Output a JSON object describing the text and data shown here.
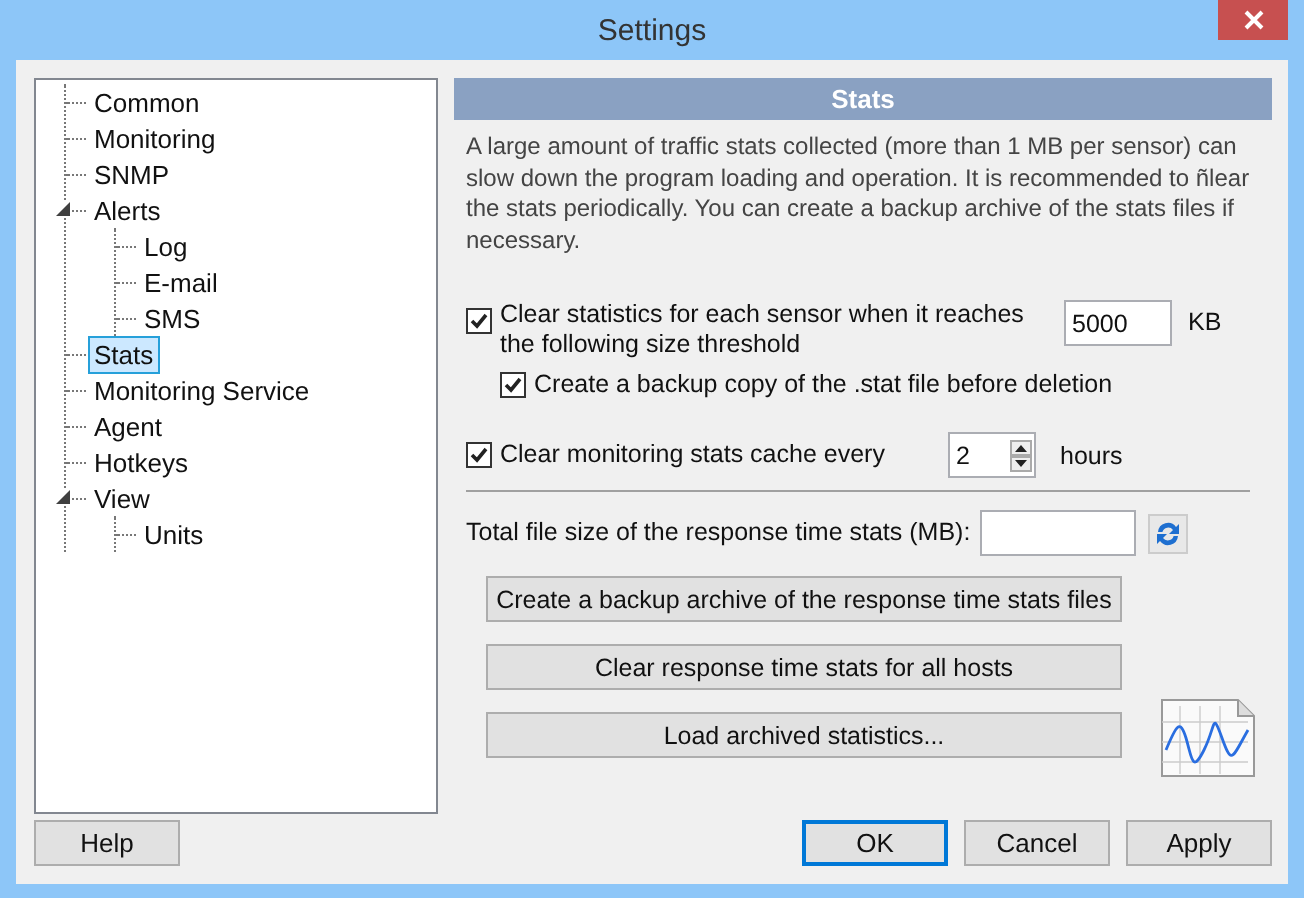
{
  "window": {
    "title": "Settings"
  },
  "tree": [
    {
      "label": "Common",
      "selected": false
    },
    {
      "label": "Monitoring",
      "selected": false
    },
    {
      "label": "SNMP",
      "selected": false
    },
    {
      "label": "Alerts",
      "selected": false,
      "expanded": true,
      "children": [
        {
          "label": "Log",
          "selected": false
        },
        {
          "label": "E-mail",
          "selected": false
        },
        {
          "label": "SMS",
          "selected": false
        }
      ]
    },
    {
      "label": "Stats",
      "selected": true
    },
    {
      "label": "Monitoring Service",
      "selected": false
    },
    {
      "label": "Agent",
      "selected": false
    },
    {
      "label": "Hotkeys",
      "selected": false
    },
    {
      "label": "View",
      "selected": false,
      "expanded": true,
      "children": [
        {
          "label": "Units",
          "selected": false
        }
      ]
    }
  ],
  "panel": {
    "title": "Stats",
    "description": "A large amount of traffic stats collected (more than 1 MB per sensor) can slow down the program loading and operation. It is recommended to ñlear the stats periodically. You can create a backup archive of the stats files if necessary.",
    "options": [
      {
        "kind": "threshold",
        "label": "Clear statistics for each sensor when it reaches the following size threshold",
        "checked": true,
        "value": "5000",
        "unit": "KB"
      },
      {
        "kind": "sub",
        "label": "Create a backup copy of the .stat file before deletion",
        "checked": true
      },
      {
        "kind": "interval",
        "label": "Clear monitoring stats cache every",
        "checked": true,
        "value": "2",
        "unit": "hours"
      }
    ],
    "total_size": {
      "label": "Total file size of the response time stats (MB):"
    },
    "actions": [
      "Create a backup archive of the response time stats files",
      "Clear response time stats for all hosts",
      "Load archived statistics..."
    ]
  },
  "buttons": [
    {
      "label": "Help",
      "default": false
    },
    {
      "label": "OK",
      "default": true
    },
    {
      "label": "Cancel",
      "default": false
    },
    {
      "label": "Apply",
      "default": false
    }
  ]
}
